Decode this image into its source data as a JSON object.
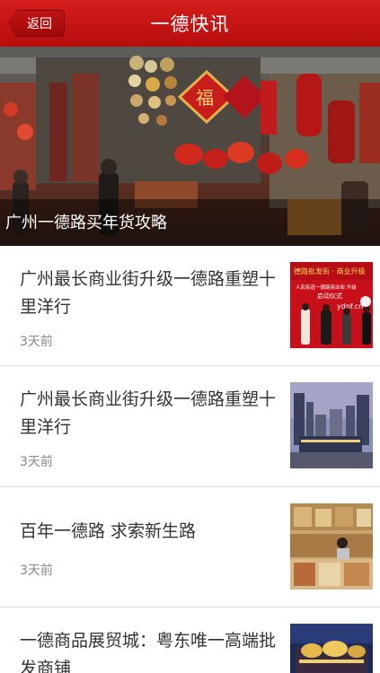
{
  "header": {
    "back_label": "返回",
    "title": "一德快讯"
  },
  "hero": {
    "caption": "广州一德路买年货攻略",
    "image": "market-stall-photo"
  },
  "news": [
    {
      "title": "广州最长商业街升级一德路重塑十里洋行",
      "time": "3天前",
      "thumb": "ceremony-photo"
    },
    {
      "title": "广州最长商业街升级一德路重塑十里洋行",
      "time": "3天前",
      "thumb": "city-buildings-photo"
    },
    {
      "title": "百年一德路 求索新生路",
      "time": "3天前",
      "thumb": "dried-goods-shop-photo"
    },
    {
      "title": "一德商品展贸城：粤东唯一高端批发商铺",
      "time": "",
      "thumb": "night-building-photo"
    }
  ],
  "thumb_texts": {
    "banner_line1": "德路批发街 · 商业升级",
    "banner_line2": "人民街道一德路商业街 升级",
    "banner_line3": "启动仪式",
    "banner_url": "ydpf.cn"
  }
}
